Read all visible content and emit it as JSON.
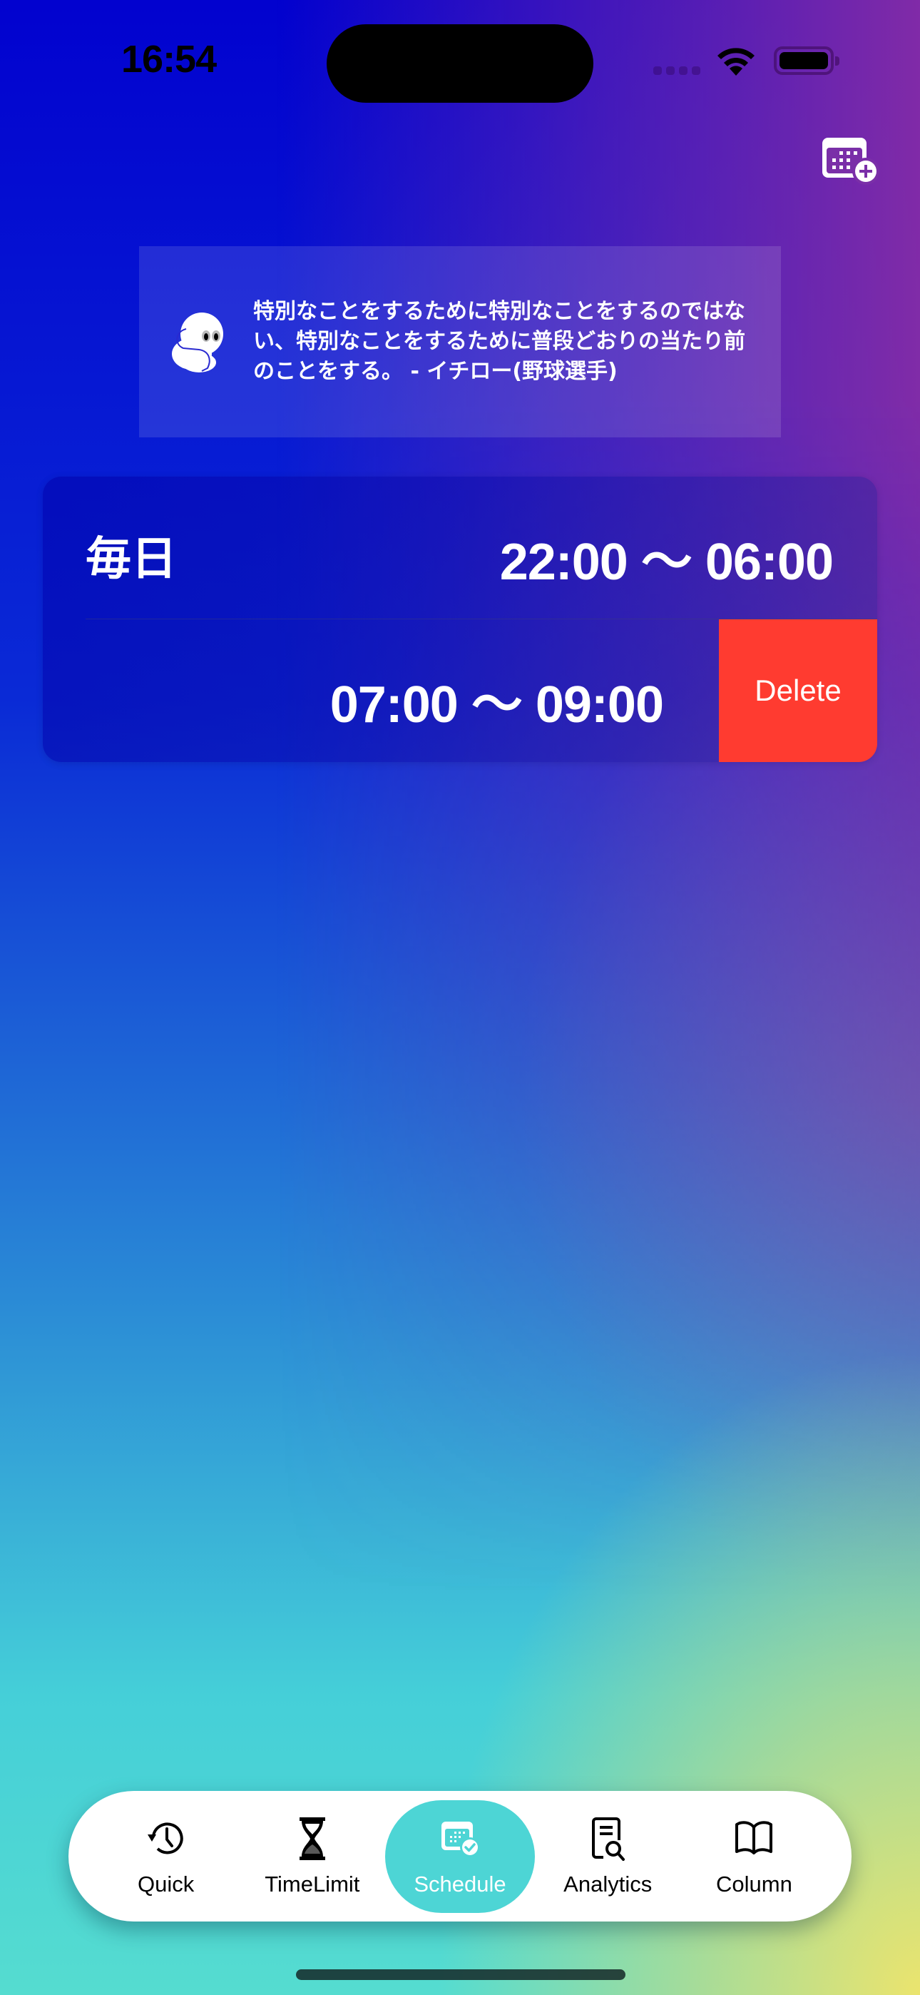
{
  "status_bar": {
    "time": "16:54"
  },
  "header": {
    "add_schedule_icon": "calendar-plus-icon"
  },
  "quote": {
    "mascot_icon": "ghost-mascot-icon",
    "text": "特別なことをするために特別なことをするのではない、特別なことをするために普段どおりの当たり前のことをする。 - イチロー(野球選手)"
  },
  "schedule": {
    "day_label": "毎日",
    "entries": [
      {
        "time_range": "22:00 〜 06:00"
      },
      {
        "time_range": "07:00 〜 09:00",
        "swipe_action": "Delete"
      }
    ]
  },
  "tabbar": {
    "active": "Schedule",
    "active_color": "#4dd5d5",
    "tabs": [
      {
        "label": "Quick",
        "icon": "clock-history-icon"
      },
      {
        "label": "TimeLimit",
        "icon": "hourglass-icon"
      },
      {
        "label": "Schedule",
        "icon": "calendar-check-icon"
      },
      {
        "label": "Analytics",
        "icon": "document-search-icon"
      },
      {
        "label": "Column",
        "icon": "book-icon"
      }
    ]
  },
  "colors": {
    "delete": "#ff3b30"
  }
}
